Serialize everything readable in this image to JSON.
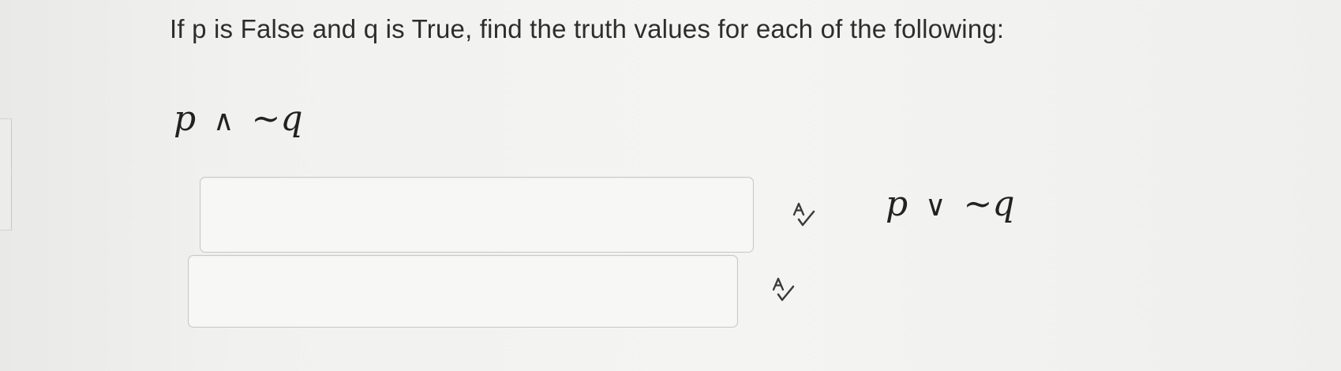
{
  "question": {
    "text": "If p is False and q is True, find the truth values for each of the following:"
  },
  "expressions": [
    {
      "left": "p",
      "operator": "∧",
      "right": "~q"
    },
    {
      "left": "p",
      "operator": "∨",
      "right": "~q"
    }
  ],
  "answers": [
    {
      "value": "",
      "placeholder": ""
    },
    {
      "value": "",
      "placeholder": ""
    }
  ],
  "icons": {
    "spellcheck": "spellcheck-icon"
  }
}
